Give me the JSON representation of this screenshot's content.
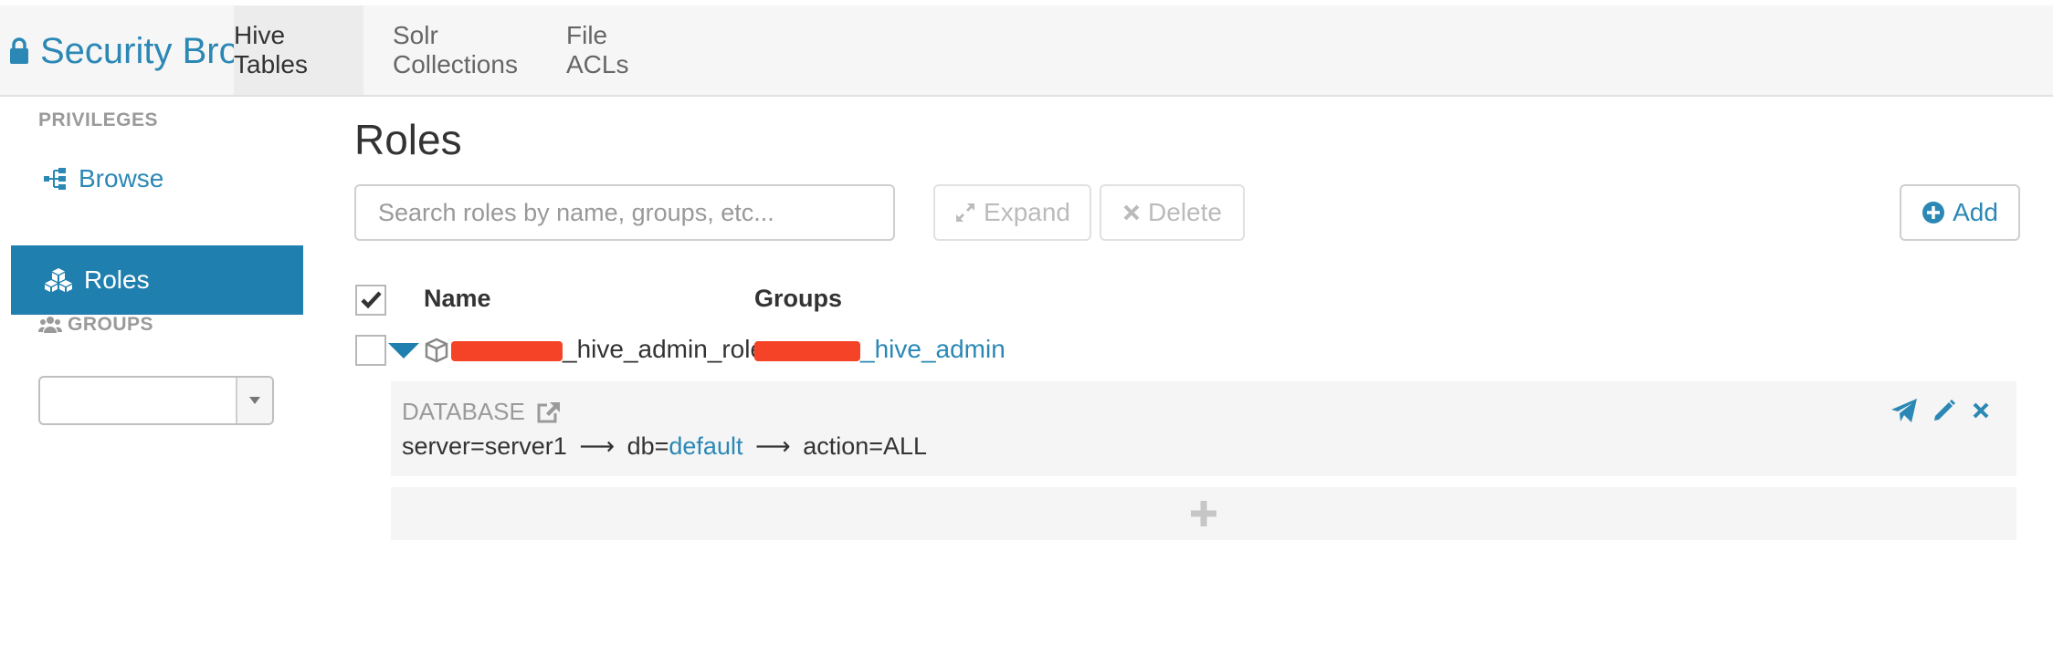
{
  "app": {
    "title": "Security Browser",
    "nav_tabs": [
      {
        "label": "Hive Tables",
        "active": true
      },
      {
        "label": "Solr Collections",
        "active": false
      },
      {
        "label": "File ACLs",
        "active": false
      }
    ]
  },
  "sidebar": {
    "privileges_header": "PRIVILEGES",
    "items": [
      {
        "label": "Browse",
        "icon": "sitemap-icon",
        "active": false
      },
      {
        "label": "Roles",
        "icon": "cubes-icon",
        "active": true
      }
    ],
    "groups_header": "GROUPS",
    "groups_select_value": ""
  },
  "main": {
    "title": "Roles",
    "search": {
      "placeholder": "Search roles by name, groups, etc...",
      "value": ""
    },
    "buttons": {
      "expand": "Expand",
      "delete": "Delete",
      "add": "Add"
    },
    "table": {
      "columns": [
        "Name",
        "Groups"
      ],
      "rows": [
        {
          "name_suffix": "_hive_admin_role",
          "groups_suffix": "_hive_admin",
          "expanded": true,
          "privileges": [
            {
              "type": "DATABASE",
              "server_label": "server=server1",
              "db_prefix": "db=",
              "db_value": "default",
              "action": "action=ALL"
            }
          ]
        }
      ]
    }
  },
  "colors": {
    "accent": "#2b88b5",
    "active_sidebar": "#1f7fae",
    "redaction": "#f44326"
  }
}
